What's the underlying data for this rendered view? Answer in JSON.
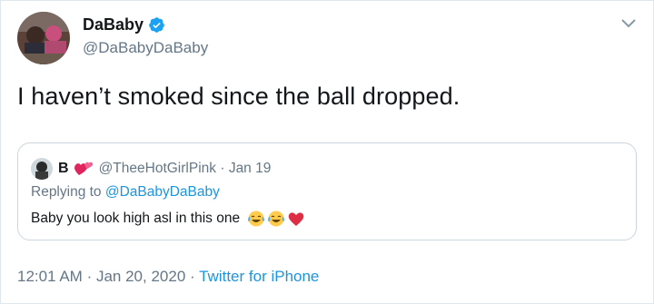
{
  "author": {
    "display_name": "DaBaby",
    "handle": "@DaBabyDaBaby",
    "verified": true,
    "avatar_icon": "avatar-image"
  },
  "tweet": {
    "text": "I haven’t smoked since the ball dropped."
  },
  "quoted_tweet": {
    "display_name": "B",
    "name_emoji": "heart-sparkle-icon",
    "handle": "@TheeHotGirlPink",
    "separator": "·",
    "date": "Jan 19",
    "replying_prefix": "Replying to",
    "replying_to": "@DaBabyDaBaby",
    "text": "Baby you look high asl in this one",
    "text_emojis": [
      "tears-of-joy-emoji",
      "tears-of-joy-emoji",
      "red-heart-emoji"
    ]
  },
  "meta": {
    "time": "12:01 AM",
    "separator": "·",
    "date": "Jan 20, 2020",
    "source": "Twitter for iPhone"
  },
  "colors": {
    "link": "#1b95e0",
    "muted": "#657786",
    "text": "#14171a",
    "border": "#ccd6dd"
  }
}
